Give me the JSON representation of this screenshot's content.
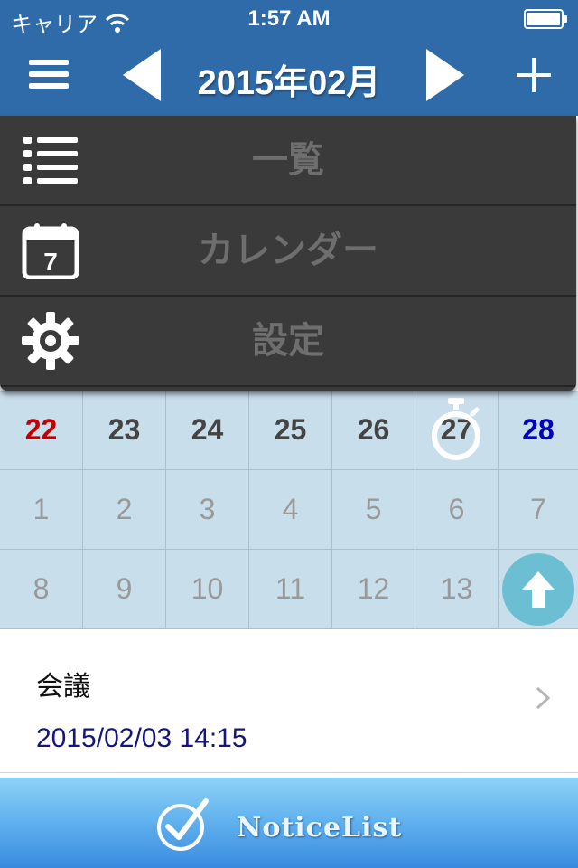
{
  "status_bar": {
    "carrier": "キャリア",
    "time": "1:57 AM"
  },
  "nav": {
    "title": "2015年02月"
  },
  "menu": {
    "items": [
      {
        "label": "一覧",
        "icon": "list-icon"
      },
      {
        "label": "カレンダー",
        "icon": "calendar-icon",
        "icon_text": "7"
      },
      {
        "label": "設定",
        "icon": "gear-icon"
      }
    ]
  },
  "calendar": {
    "weeks": [
      [
        "22",
        "23",
        "24",
        "25",
        "26",
        "27",
        "28"
      ],
      [
        "1",
        "2",
        "3",
        "4",
        "5",
        "6",
        "7"
      ],
      [
        "8",
        "9",
        "10",
        "11",
        "12",
        "13",
        ""
      ]
    ]
  },
  "event": {
    "title": "会議",
    "datetime": "2015/02/03 14:15"
  },
  "footer": {
    "brand": "NoticeList"
  },
  "colors": {
    "header": "#2f6ba8",
    "calendar_bg": "#c9deeb",
    "sunday": "#c00000",
    "saturday": "#0000c0",
    "up_button": "#6cbfd2"
  }
}
